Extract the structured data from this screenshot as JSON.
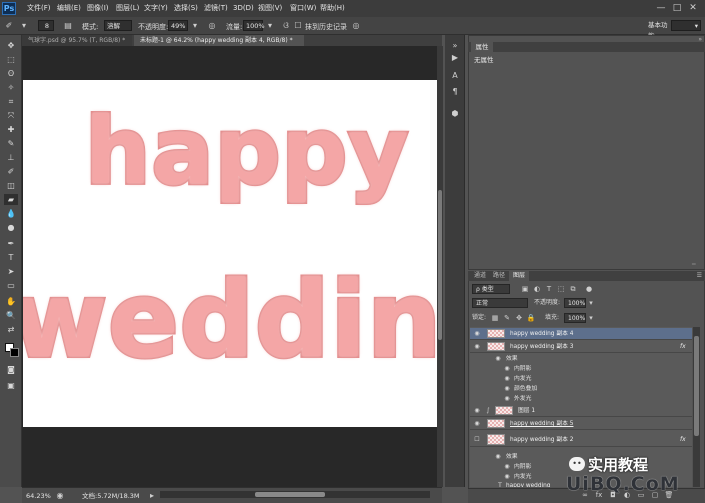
{
  "app": {
    "logo": "Ps"
  },
  "menu": [
    "文件(F)",
    "编辑(E)",
    "图像(I)",
    "图层(L)",
    "文字(Y)",
    "选择(S)",
    "滤镜(T)",
    "3D(D)",
    "视图(V)",
    "窗口(W)",
    "帮助(H)"
  ],
  "window_controls": [
    "—",
    "□",
    "✕"
  ],
  "options": {
    "brush_size": "8",
    "mode_label": "模式:",
    "mode_value": "溶解",
    "opacity_label": "不透明度:",
    "opacity_value": "49%",
    "flow_label": "流量:",
    "flow_value": "100%",
    "history_label": "抹到历史记录",
    "workspace": "基本功能"
  },
  "tabs": [
    {
      "label": "气球字.psd @ 95.7% (T, RGB/8) *",
      "active": false
    },
    {
      "label": "未标题-1 @ 64.2% (happy wedding 副本 4, RGB/8) *",
      "active": true
    }
  ],
  "canvas": {
    "line1": "happy",
    "line2": "weddin"
  },
  "status": {
    "zoom": "64.23%",
    "doc": "文档:5.72M/18.3M"
  },
  "properties": {
    "tab": "属性",
    "message": "无属性"
  },
  "layers_panel": {
    "tabs": [
      "通道",
      "路径",
      "图层"
    ],
    "filter_kind": "ρ 类型",
    "blend_mode": "正常",
    "opacity_label": "不透明度:",
    "opacity_value": "100%",
    "lock_label": "锁定:",
    "fill_label": "填充:",
    "fill_value": "100%"
  },
  "layers": [
    {
      "name": "happy wedding 副本 4",
      "selected": true
    },
    {
      "name": "happy wedding 副本 3",
      "fx": "fx",
      "effects_title": "效果",
      "effects": [
        "内阴影",
        "内发光",
        "颜色叠加",
        "外发光"
      ]
    },
    {
      "name": "图层 1"
    },
    {
      "name": "happy wedding 副本 5"
    },
    {
      "name": "happy wedding 副本 2",
      "fx": "fx",
      "effects_title": "效果",
      "effects": [
        "内阴影",
        "内发光"
      ]
    },
    {
      "name": "happy wedding"
    }
  ],
  "watermark": {
    "text": "实用教程",
    "logo": "UiBQ.CoM"
  }
}
